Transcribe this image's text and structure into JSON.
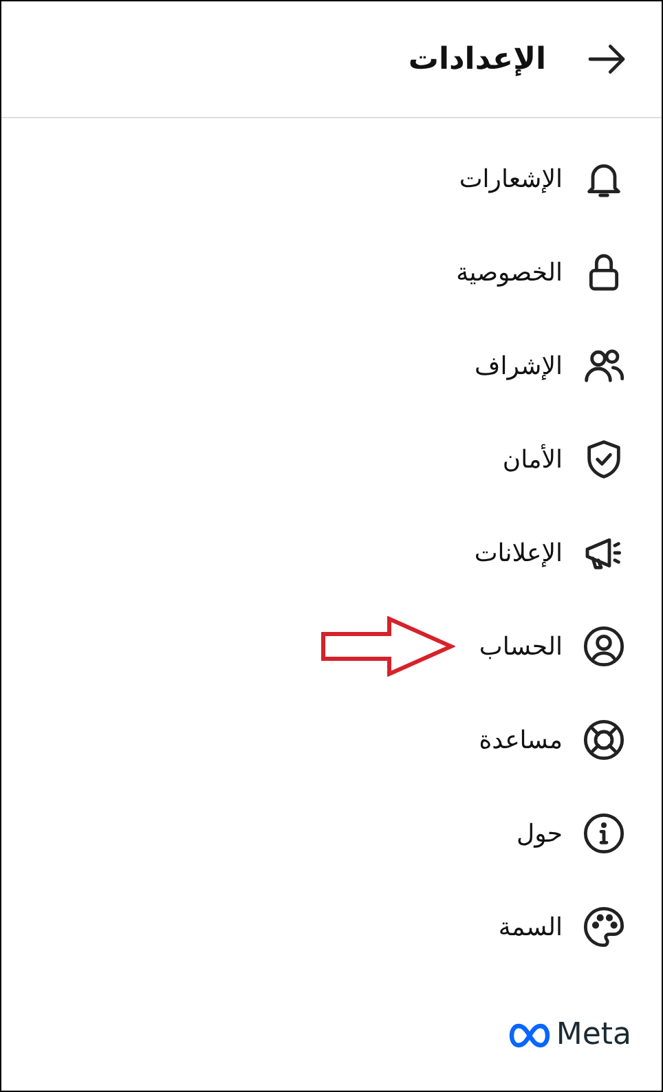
{
  "header": {
    "title": "الإعدادات"
  },
  "items": [
    {
      "label": "الإشعارات",
      "kind": "bell",
      "annotated": false
    },
    {
      "label": "الخصوصية",
      "kind": "lock",
      "annotated": false
    },
    {
      "label": "الإشراف",
      "kind": "people",
      "annotated": false
    },
    {
      "label": "الأمان",
      "kind": "shield",
      "annotated": false
    },
    {
      "label": "الإعلانات",
      "kind": "megaphone",
      "annotated": false
    },
    {
      "label": "الحساب",
      "kind": "person",
      "annotated": true
    },
    {
      "label": "مساعدة",
      "kind": "lifebuoy",
      "annotated": false
    },
    {
      "label": "حول",
      "kind": "info",
      "annotated": false
    },
    {
      "label": "السمة",
      "kind": "palette",
      "annotated": false
    }
  ],
  "footer": {
    "logo_text": "Meta"
  }
}
